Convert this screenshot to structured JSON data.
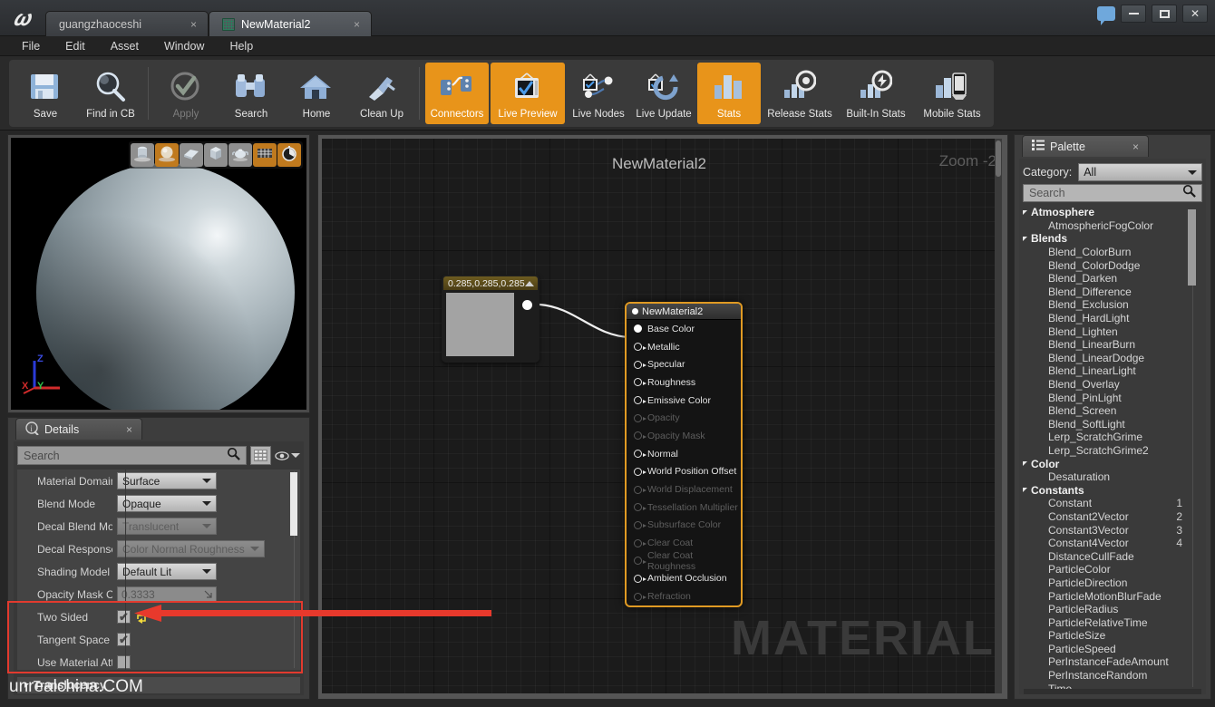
{
  "window": {
    "logo": "unreal-logo",
    "tabs": [
      {
        "label": "guangzhaoceshi",
        "close": "×",
        "active": false
      },
      {
        "label": "NewMaterial2",
        "close": "×",
        "active": true
      }
    ],
    "controls": {
      "minimize": "minimize-button",
      "restore": "restore-button",
      "close": "✕"
    }
  },
  "menubar": {
    "items": [
      "File",
      "Edit",
      "Asset",
      "Window",
      "Help"
    ]
  },
  "toolbar": {
    "buttons": [
      {
        "label": "Save",
        "icon": "save-disk-icon",
        "state": "normal"
      },
      {
        "label": "Find in CB",
        "icon": "magnifier-icon",
        "state": "normal"
      },
      {
        "label": "Apply",
        "icon": "check-circle-icon",
        "state": "disabled"
      },
      {
        "label": "Search",
        "icon": "binoculars-icon",
        "state": "normal"
      },
      {
        "label": "Home",
        "icon": "house-icon",
        "state": "normal"
      },
      {
        "label": "Clean Up",
        "icon": "broom-icon",
        "state": "normal"
      },
      {
        "label": "Connectors",
        "icon": "connectors-icon",
        "state": "active"
      },
      {
        "label": "Live Preview",
        "icon": "monitor-check-icon",
        "state": "active"
      },
      {
        "label": "Live Nodes",
        "icon": "nodes-check-icon",
        "state": "normal"
      },
      {
        "label": "Live Update",
        "icon": "refresh-check-icon",
        "state": "normal"
      },
      {
        "label": "Stats",
        "icon": "bar-chart-icon",
        "state": "active"
      },
      {
        "label": "Release Stats",
        "icon": "target-stats-icon",
        "state": "normal"
      },
      {
        "label": "Built-In Stats",
        "icon": "bolt-stats-icon",
        "state": "normal"
      },
      {
        "label": "Mobile Stats",
        "icon": "mobile-stats-icon",
        "state": "normal"
      }
    ]
  },
  "viewport": {
    "shapes": [
      {
        "name": "cylinder",
        "selected": false
      },
      {
        "name": "sphere",
        "selected": true
      },
      {
        "name": "plane",
        "selected": false
      },
      {
        "name": "cube",
        "selected": false
      },
      {
        "name": "teapot",
        "selected": false
      },
      {
        "name": "grid",
        "selected": true
      },
      {
        "name": "realtime",
        "selected": true
      }
    ],
    "axes": {
      "x": "X",
      "y": "Y",
      "z": "Z"
    }
  },
  "details": {
    "tab_label": "Details",
    "tab_close": "×",
    "search_placeholder": "Search",
    "search_value": "",
    "properties": [
      {
        "label": "Material Domain",
        "type": "dropdown",
        "value": "Surface",
        "disabled": false
      },
      {
        "label": "Blend Mode",
        "type": "dropdown",
        "value": "Opaque",
        "disabled": false
      },
      {
        "label": "Decal Blend Mode",
        "type": "dropdown",
        "value": "Translucent",
        "disabled": true
      },
      {
        "label": "Decal Response",
        "type": "dropdown",
        "value": "Color Normal Roughness",
        "disabled": true
      },
      {
        "label": "Shading Model",
        "type": "dropdown",
        "value": "Default Lit",
        "disabled": false
      },
      {
        "label": "Opacity Mask Clip Value",
        "type": "number",
        "value": "0.3333",
        "disabled": true
      },
      {
        "label": "Two Sided",
        "type": "checkbox",
        "checked": true,
        "has_reset": true
      },
      {
        "label": "Tangent Space Normal",
        "type": "checkbox",
        "checked": true,
        "has_reset": false
      },
      {
        "label": "Use Material Attributes",
        "type": "checkbox",
        "checked": false,
        "has_reset": false
      }
    ],
    "bottom_category": "Translucency"
  },
  "graph": {
    "title": "NewMaterial2",
    "zoom_label": "Zoom -2",
    "watermark": "MATERIAL",
    "constant_node": {
      "title": "0.285,0.285,0.285",
      "swatch_color": "#a3a3a3"
    },
    "material_node": {
      "title": "NewMaterial2",
      "accent_color": "#e09a23",
      "inputs": [
        {
          "label": "Base Color",
          "enabled": true,
          "connected": true
        },
        {
          "label": "Metallic",
          "enabled": true,
          "connected": false
        },
        {
          "label": "Specular",
          "enabled": true,
          "connected": false
        },
        {
          "label": "Roughness",
          "enabled": true,
          "connected": false
        },
        {
          "label": "Emissive Color",
          "enabled": true,
          "connected": false
        },
        {
          "label": "Opacity",
          "enabled": false,
          "connected": false
        },
        {
          "label": "Opacity Mask",
          "enabled": false,
          "connected": false
        },
        {
          "label": "Normal",
          "enabled": true,
          "connected": false
        },
        {
          "label": "World Position Offset",
          "enabled": true,
          "connected": false
        },
        {
          "label": "World Displacement",
          "enabled": false,
          "connected": false
        },
        {
          "label": "Tessellation Multiplier",
          "enabled": false,
          "connected": false
        },
        {
          "label": "Subsurface Color",
          "enabled": false,
          "connected": false
        },
        {
          "label": "Clear Coat",
          "enabled": false,
          "connected": false
        },
        {
          "label": "Clear Coat Roughness",
          "enabled": false,
          "connected": false
        },
        {
          "label": "Ambient Occlusion",
          "enabled": true,
          "connected": false
        },
        {
          "label": "Refraction",
          "enabled": false,
          "connected": false
        }
      ]
    }
  },
  "palette": {
    "tab_label": "Palette",
    "tab_close": "×",
    "category_label": "Category:",
    "category_value": "All",
    "search_placeholder": "Search",
    "search_value": "",
    "groups": [
      {
        "name": "Atmosphere",
        "items": [
          {
            "label": "AtmosphericFogColor",
            "num": ""
          }
        ]
      },
      {
        "name": "Blends",
        "items": [
          {
            "label": "Blend_ColorBurn",
            "num": ""
          },
          {
            "label": "Blend_ColorDodge",
            "num": ""
          },
          {
            "label": "Blend_Darken",
            "num": ""
          },
          {
            "label": "Blend_Difference",
            "num": ""
          },
          {
            "label": "Blend_Exclusion",
            "num": ""
          },
          {
            "label": "Blend_HardLight",
            "num": ""
          },
          {
            "label": "Blend_Lighten",
            "num": ""
          },
          {
            "label": "Blend_LinearBurn",
            "num": ""
          },
          {
            "label": "Blend_LinearDodge",
            "num": ""
          },
          {
            "label": "Blend_LinearLight",
            "num": ""
          },
          {
            "label": "Blend_Overlay",
            "num": ""
          },
          {
            "label": "Blend_PinLight",
            "num": ""
          },
          {
            "label": "Blend_Screen",
            "num": ""
          },
          {
            "label": "Blend_SoftLight",
            "num": ""
          },
          {
            "label": "Lerp_ScratchGrime",
            "num": ""
          },
          {
            "label": "Lerp_ScratchGrime2",
            "num": ""
          }
        ]
      },
      {
        "name": "Color",
        "items": [
          {
            "label": "Desaturation",
            "num": ""
          }
        ]
      },
      {
        "name": "Constants",
        "items": [
          {
            "label": "Constant",
            "num": "1"
          },
          {
            "label": "Constant2Vector",
            "num": "2"
          },
          {
            "label": "Constant3Vector",
            "num": "3"
          },
          {
            "label": "Constant4Vector",
            "num": "4"
          },
          {
            "label": "DistanceCullFade",
            "num": ""
          },
          {
            "label": "ParticleColor",
            "num": ""
          },
          {
            "label": "ParticleDirection",
            "num": ""
          },
          {
            "label": "ParticleMotionBlurFade",
            "num": ""
          },
          {
            "label": "ParticleRadius",
            "num": ""
          },
          {
            "label": "ParticleRelativeTime",
            "num": ""
          },
          {
            "label": "ParticleSize",
            "num": ""
          },
          {
            "label": "ParticleSpeed",
            "num": ""
          },
          {
            "label": "PerInstanceFadeAmount",
            "num": ""
          },
          {
            "label": "PerInstanceRandom",
            "num": ""
          },
          {
            "label": "Time",
            "num": ""
          }
        ]
      }
    ]
  },
  "annotation": {
    "watermark": "unrealchina.COM",
    "highlight_color": "#e23a2e"
  }
}
